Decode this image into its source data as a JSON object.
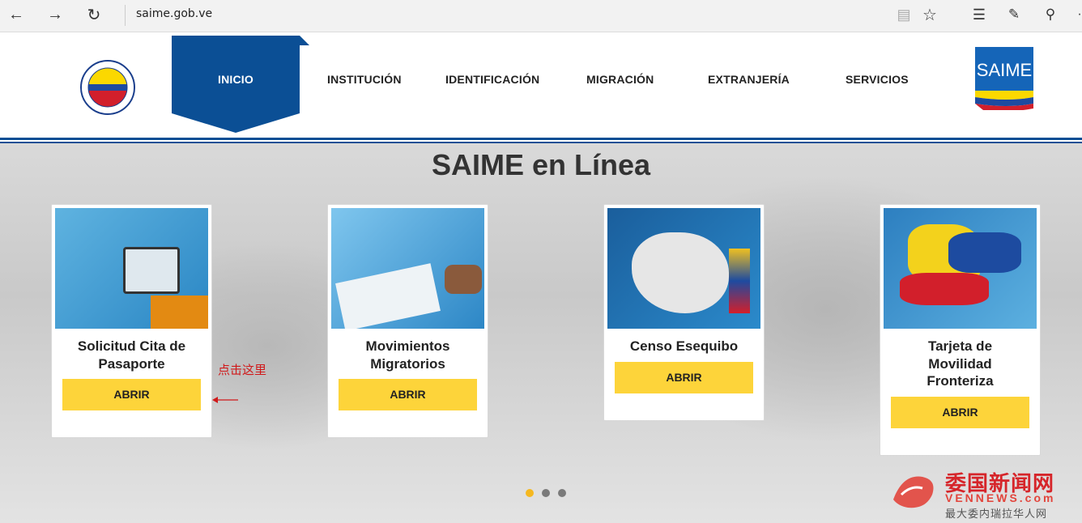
{
  "browser": {
    "url": "saime.gob.ve"
  },
  "nav": {
    "items": [
      "INICIO",
      "INSTITUCIÓN",
      "IDENTIFICACIÓN",
      "MIGRACIÓN",
      "EXTRANJERÍA",
      "SERVICIOS"
    ]
  },
  "logo": {
    "text": "SAIME"
  },
  "hero": {
    "title": "SAIME en Línea"
  },
  "cards": [
    {
      "title_line1": "Solicitud Cita de",
      "title_line2": "Pasaporte",
      "button": "ABRIR"
    },
    {
      "title_line1": "Movimientos",
      "title_line2": "Migratorios",
      "button": "ABRIR"
    },
    {
      "title_line1": "Censo Esequibo",
      "button": "ABRIR"
    },
    {
      "title_line1": "Tarjeta de",
      "title_line2": "Movilidad",
      "title_line3": "Fronteriza",
      "button": "ABRIR"
    }
  ],
  "annotation": {
    "text": "点击这里"
  },
  "watermark": {
    "title": "委国新闻网",
    "domain": "VENNEWS.com",
    "tagline": "最大委内瑞拉华人网"
  },
  "colors": {
    "nav_active": "#0b4f95",
    "button": "#fdd43a",
    "dot_active": "#f5b820"
  }
}
